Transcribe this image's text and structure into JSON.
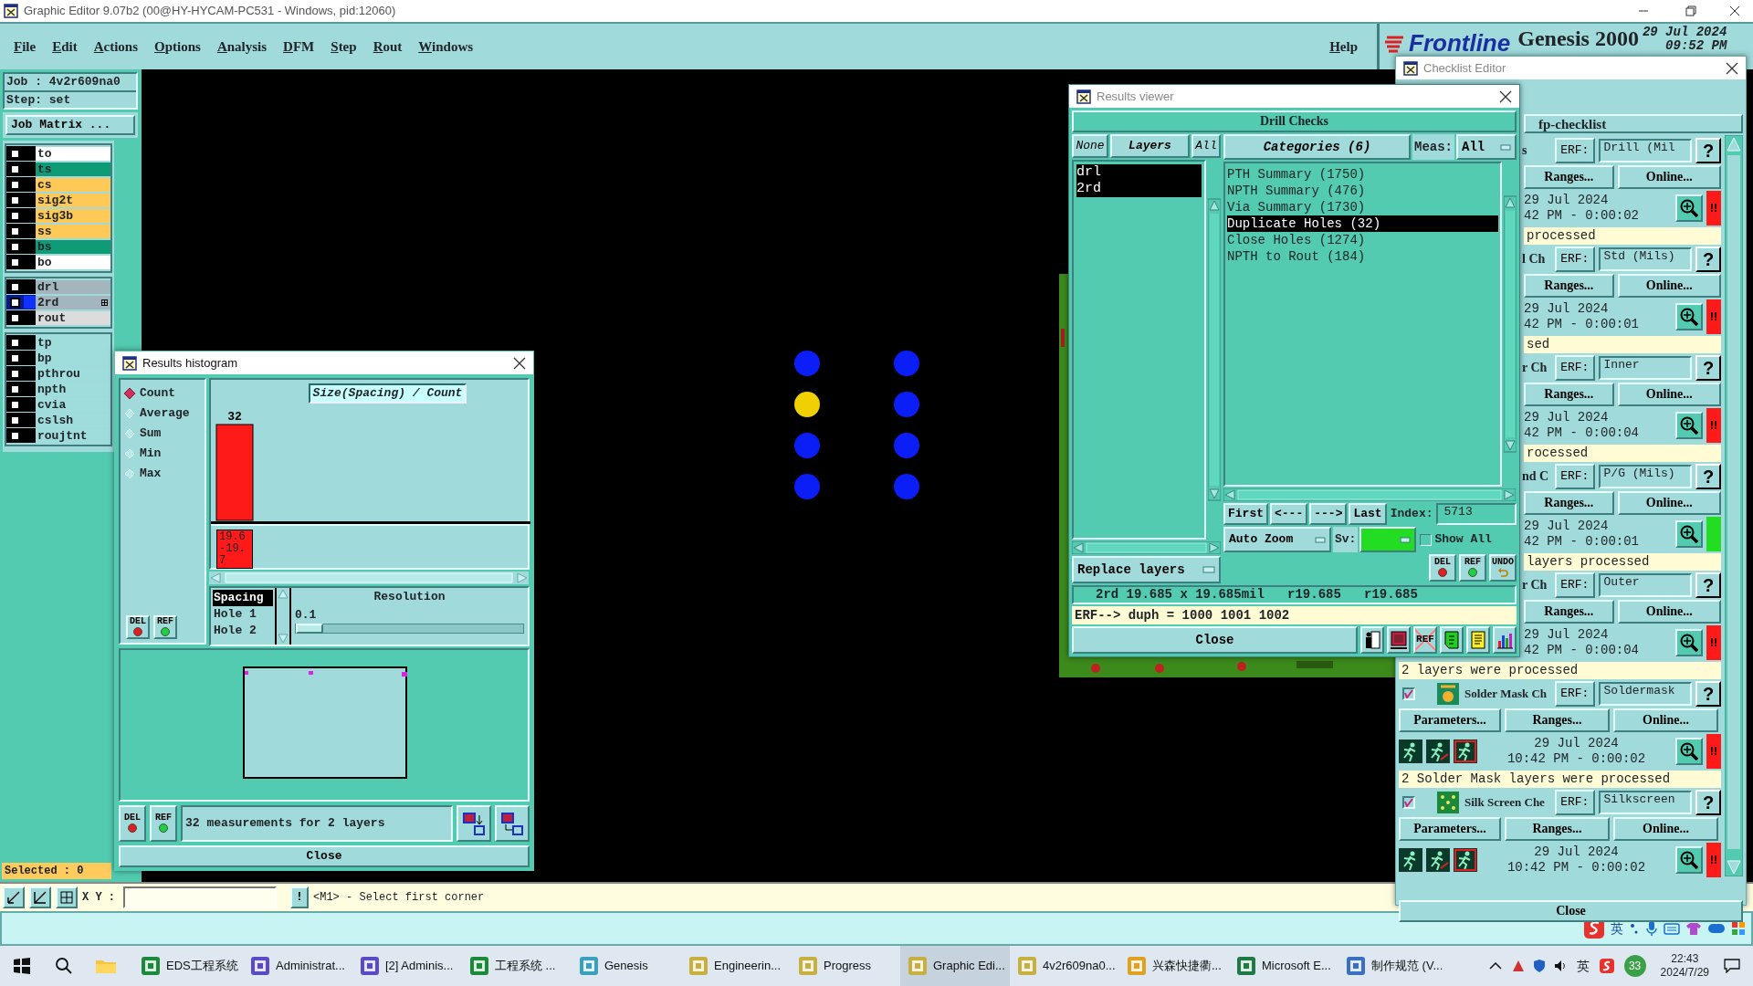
{
  "app": {
    "title": "Graphic Editor 9.07b2 (00@HY-HYCAM-PC531 - Windows, pid:12060)",
    "menu": [
      "File",
      "Edit",
      "Actions",
      "Options",
      "Analysis",
      "DFM",
      "Step",
      "Rout",
      "Windows"
    ],
    "help": "Help",
    "brand": {
      "logo": "Frontline",
      "product": "Genesis 2000",
      "date": "29 Jul 2024",
      "time": "09:52 PM"
    }
  },
  "job": {
    "job": "Job : 4v2r609na0",
    "step": "Step: set",
    "matrix_button": "Job Matrix ..."
  },
  "layer_groups": [
    [
      {
        "name": "to",
        "color": "#ffffff",
        "checked": false,
        "selected": false
      },
      {
        "name": "ts",
        "color": "#0f9b76",
        "checked": false,
        "selected": false
      },
      {
        "name": "cs",
        "color": "#ffc957",
        "checked": false,
        "selected": false
      },
      {
        "name": "sig2t",
        "color": "#ffc957",
        "checked": false,
        "selected": false
      },
      {
        "name": "sig3b",
        "color": "#ffc957",
        "checked": false,
        "selected": false
      },
      {
        "name": "ss",
        "color": "#ffc957",
        "checked": false,
        "selected": false
      },
      {
        "name": "bs",
        "color": "#0f9b76",
        "checked": false,
        "selected": false
      },
      {
        "name": "bo",
        "color": "#ffffff",
        "checked": false,
        "selected": false
      }
    ],
    [
      {
        "name": "drl",
        "color": "#a3b5bd",
        "checked": false,
        "selected": false
      },
      {
        "name": "2rd",
        "color": "#a3b5bd",
        "checked": false,
        "selected": true
      },
      {
        "name": "rout",
        "color": "#dcdcdc",
        "checked": false,
        "selected": false
      }
    ],
    [
      {
        "name": "tp",
        "color": "#9fdcdc",
        "checked": false,
        "selected": false
      },
      {
        "name": "bp",
        "color": "#9fdcdc",
        "checked": false,
        "selected": false
      },
      {
        "name": "pthrou",
        "color": "#9fdcdc",
        "checked": false,
        "selected": false
      },
      {
        "name": "npth",
        "color": "#9fdcdc",
        "checked": false,
        "selected": false
      },
      {
        "name": "cvia",
        "color": "#9fdcdc",
        "checked": false,
        "selected": false
      },
      {
        "name": "cslsh",
        "color": "#9fdcdc",
        "checked": false,
        "selected": false
      },
      {
        "name": "roujtnt",
        "color": "#9fdcdc",
        "checked": false,
        "selected": false
      }
    ]
  ],
  "selected_count": "Selected : 0",
  "canvas": {
    "holes": [
      {
        "color": "#0a1ef5"
      },
      {
        "color": "#0a1ef5"
      },
      {
        "color": "#f0d000"
      },
      {
        "color": "#0a1ef5"
      },
      {
        "color": "#0a1ef5"
      },
      {
        "color": "#0a1ef5"
      },
      {
        "color": "#0a1ef5"
      },
      {
        "color": "#0a1ef5"
      }
    ]
  },
  "histogram": {
    "title": "Results histogram",
    "modes": [
      {
        "label": "Count",
        "selected": true
      },
      {
        "label": "Average",
        "selected": false
      },
      {
        "label": "Sum",
        "selected": false
      },
      {
        "label": "Min",
        "selected": false
      },
      {
        "label": "Max",
        "selected": false
      }
    ],
    "chart_data": {
      "type": "bar",
      "title": "Size(Spacing) / Count",
      "categories": [
        "19.6-19.7"
      ],
      "values": [
        32
      ],
      "data_labels": true
    },
    "fields": [
      {
        "label": "Spacing",
        "selected": true
      },
      {
        "label": "Hole 1",
        "selected": false
      },
      {
        "label": "Hole 2",
        "selected": false
      }
    ],
    "resolution": {
      "label": "Resolution",
      "value": "0.1",
      "level": 0.0
    },
    "tools": [
      {
        "label": "DEL",
        "kind": "del"
      },
      {
        "label": "REF",
        "kind": "ref"
      }
    ],
    "bottom_tools": [
      {
        "label": "DEL",
        "kind": "del"
      },
      {
        "label": "REF",
        "kind": "ref"
      }
    ],
    "summary": "32 measurements for 2 layers",
    "close": "Close"
  },
  "viewer": {
    "title": "Results viewer",
    "header": "Drill Checks",
    "layer_none": "None",
    "layer_title": "Layers",
    "layer_all": "All",
    "layers": [
      {
        "name": "drl",
        "selected": true
      },
      {
        "name": "2rd",
        "selected": true
      }
    ],
    "categories_title": "Categories (6)",
    "meas_label": "Meas:",
    "meas_value": "All",
    "categories": [
      {
        "label": "PTH Summary (1750)",
        "selected": false
      },
      {
        "label": "NPTH Summary (476)",
        "selected": false
      },
      {
        "label": "Via Summary (1730)",
        "selected": false
      },
      {
        "label": "Duplicate Holes (32)",
        "selected": true
      },
      {
        "label": "Close Holes (1274)",
        "selected": false
      },
      {
        "label": "NPTH to Rout (184)",
        "selected": false
      }
    ],
    "nav": [
      "First",
      "<---",
      "--->",
      "Last"
    ],
    "index_label": "Index:",
    "index_value": "5713",
    "zoom_mode": "Auto Zoom",
    "sv_label": "Sv:",
    "show_all": {
      "label": "Show All",
      "checked": false
    },
    "replace": "Replace layers",
    "tools": [
      {
        "label": "DEL",
        "kind": "del"
      },
      {
        "label": "REF",
        "kind": "ref"
      },
      {
        "label": "UNDO",
        "kind": "undo"
      }
    ],
    "info": "2rd 19.685 x 19.685mil   r19.685   r19.685",
    "erf": "ERF--> duph = 1000 1001 1002",
    "close": "Close",
    "actions": [
      {
        "kind": "exit"
      },
      {
        "kind": "stop"
      },
      {
        "kind": "clear",
        "label": "REF"
      },
      {
        "kind": "page"
      },
      {
        "kind": "report"
      },
      {
        "kind": "chart"
      }
    ]
  },
  "checklist": {
    "title": "Checklist Editor",
    "name": "fp-checklist",
    "items": [
      {
        "kind": "covered",
        "title": "s",
        "erf_label": "ERF:",
        "erf": "Drill (Mil",
        "help": "?",
        "buttons": [
          "Ranges...",
          "Online..."
        ],
        "date": "29 Jul 2024",
        "time": "42 PM - 0:00:02",
        "failed": true,
        "flag": "!!",
        "message": "processed"
      },
      {
        "kind": "covered",
        "title": "l Ch",
        "erf_label": "ERF:",
        "erf": "Std (Mils)",
        "help": "?",
        "buttons": [
          "Ranges...",
          "Online..."
        ],
        "date": "29 Jul 2024",
        "time": "42 PM - 0:00:01",
        "failed": true,
        "flag": "!!",
        "message": "sed"
      },
      {
        "kind": "covered",
        "title": "r Ch",
        "erf_label": "ERF:",
        "erf": "Inner",
        "help": "?",
        "buttons": [
          "Ranges...",
          "Online..."
        ],
        "date": "29 Jul 2024",
        "time": "42 PM - 0:00:04",
        "failed": true,
        "flag": "!!",
        "message": "rocessed"
      },
      {
        "kind": "covered",
        "title": "nd C",
        "erf_label": "ERF:",
        "erf": "P/G (Mils)",
        "help": "?",
        "buttons": [
          "Ranges...",
          "Online..."
        ],
        "date": "29 Jul 2024",
        "time": "42 PM - 0:00:01",
        "failed": false,
        "message": "layers processed"
      },
      {
        "kind": "top_covered",
        "title": "r Ch",
        "erf_label": "ERF:",
        "erf": "Outer",
        "help": "?",
        "buttons": [
          "Ranges...",
          "Online..."
        ],
        "date": "29 Jul 2024",
        "time": "42 PM - 0:00:04",
        "failed": true,
        "flag": "!!",
        "message": "2 layers were processed"
      },
      {
        "kind": "mask",
        "checked": true,
        "title": "Solder Mask Ch",
        "erf_label": "ERF:",
        "erf": "Soldermask",
        "help": "?",
        "buttons": [
          "Parameters...",
          "Ranges...",
          "Online..."
        ],
        "date": "29 Jul 2024",
        "time": "10:42 PM - 0:00:02",
        "failed": true,
        "flag": "!!",
        "message": "2 Solder Mask layers were processed"
      },
      {
        "kind": "silk",
        "checked": true,
        "title": "Silk Screen Che",
        "erf_label": "ERF:",
        "erf": "Silkscreen",
        "help": "?",
        "buttons": [
          "Parameters...",
          "Ranges...",
          "Online..."
        ],
        "date": "29 Jul 2024",
        "time": "10:42 PM - 0:00:02",
        "failed": true,
        "flag": "!!"
      }
    ],
    "close": "Close"
  },
  "status_bar": {
    "xy_label": "X Y :",
    "alert": "!",
    "hint": "<M1> - Select first corner"
  },
  "ime": {
    "lang": "英"
  },
  "taskbar": {
    "apps": [
      {
        "label": "EDS工程系统",
        "color": "#1a8a3a",
        "selected": false
      },
      {
        "label": "Administrat...",
        "color": "#5a4ac8",
        "selected": false
      },
      {
        "label": "[2] Adminis...",
        "color": "#5a4ac8",
        "selected": false
      },
      {
        "label": "工程系统 ...",
        "color": "#1a8a3a",
        "selected": false
      },
      {
        "label": "Genesis",
        "color": "#3aa0c0",
        "selected": false
      },
      {
        "label": "Engineerin...",
        "color": "#c8b040",
        "selected": false
      },
      {
        "label": "Progress",
        "color": "#c8b040",
        "selected": false
      },
      {
        "label": "Graphic Edi...",
        "color": "#c8b040",
        "selected": true
      },
      {
        "label": "4v2r609na0...",
        "color": "#c8b040",
        "selected": false
      },
      {
        "label": "兴森快捷衢...",
        "color": "#e0a020",
        "selected": false
      },
      {
        "label": "Microsoft E...",
        "color": "#1d7a45",
        "selected": false
      },
      {
        "label": "制作规范 (V...",
        "color": "#3b6fc0",
        "selected": false
      }
    ],
    "tray_lang": "英",
    "badge": "33",
    "time": "22:43",
    "date": "2024/7/29"
  }
}
